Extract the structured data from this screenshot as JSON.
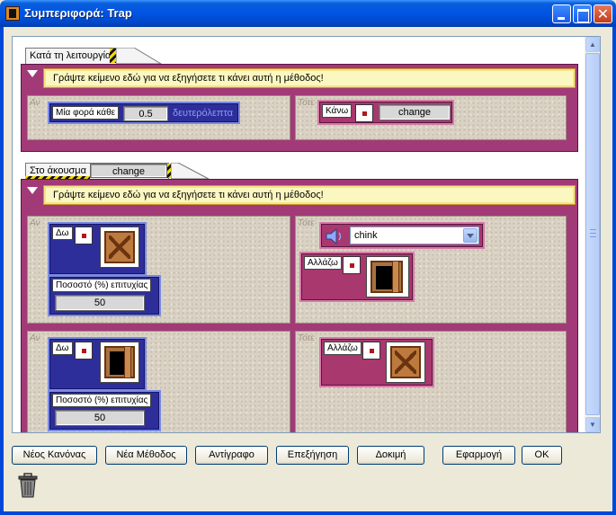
{
  "window": {
    "title": "Συμπεριφορά: Trap"
  },
  "rule1": {
    "tab_label": "Κατά τη λειτουργία",
    "description": "Γράψτε κείμενο εδώ για να εξηγήσετε τι κάνει αυτή η μέθοδος!",
    "if_label": "Αν",
    "then_label": "Τότε",
    "every_label": "Μία φορά κάθε",
    "interval_value": "0.5",
    "seconds_label": "δευτερόλεπτα",
    "do_label": "Κάνω",
    "action_value": "change"
  },
  "rule2": {
    "tab_label": "Στο άκουσμα",
    "trigger_value": "change",
    "description": "Γράψτε κείμενο εδώ για να εξηγήσετε τι κάνει αυτή η μέθοδος!",
    "subrules": [
      {
        "if_label": "Αν",
        "then_label": "Τότε",
        "see_label": "Δω",
        "see_sprite": "closed-door",
        "chance_label": "Ποσοστό (%) επιτυχίας",
        "chance_value": "50",
        "sound_value": "chink",
        "change_label": "Αλλάζω",
        "change_sprite": "open-door"
      },
      {
        "if_label": "Αν",
        "then_label": "Τότε",
        "see_label": "Δω",
        "see_sprite": "open-door",
        "chance_label": "Ποσοστό (%) επιτυχίας",
        "chance_value": "50",
        "change_label": "Αλλάζω",
        "change_sprite": "closed-door"
      }
    ]
  },
  "buttons": {
    "new_rule": "Νέος Κανόνας",
    "new_method": "Νέα Μέθοδος",
    "copy": "Αντίγραφο",
    "explain": "Επεξήγηση",
    "test": "Δοκιμή",
    "apply": "Εφαρμογή",
    "ok": "OK"
  },
  "icons": [
    "app-icon",
    "minimize-icon",
    "maximize-icon",
    "close-icon",
    "speaker-icon",
    "trash-icon"
  ],
  "colors": {
    "rule_frame": "#a23a78",
    "condition_tile": "#2e2e9a",
    "action_tile": "#a8386e",
    "description_bg": "#fbf7c0"
  }
}
